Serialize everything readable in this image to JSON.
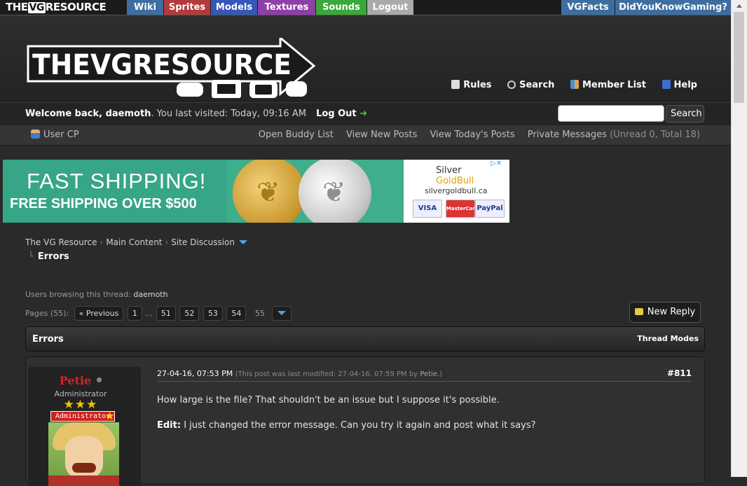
{
  "network_bar": {
    "logo": "THEVGRESOURCE",
    "logo_the": "THE",
    "logo_vg": "VG",
    "logo_rest": "RESOURCE",
    "tabs": [
      "Wiki",
      "Sprites",
      "Models",
      "Textures",
      "Sounds",
      "Logout"
    ],
    "right_tabs": [
      "VGFacts",
      "DidYouKnowGaming?"
    ],
    "tab_colors": {
      "Wiki": "#3d6ea1",
      "Sprites": "#b33b3b",
      "Models": "#3458b8",
      "Textures": "#8e3fa8",
      "Sounds": "#3ba83b",
      "Logout": "#aaaaaa"
    }
  },
  "header": {
    "logo_text": "THEVGRESOURCE",
    "links": [
      {
        "label": "Rules",
        "icon": "document-icon"
      },
      {
        "label": "Search",
        "icon": "magnifier-icon"
      },
      {
        "label": "Member List",
        "icon": "users-icon"
      },
      {
        "label": "Help",
        "icon": "help-icon"
      }
    ]
  },
  "welcome": {
    "prefix": "Welcome back, ",
    "username": "daemoth",
    "visited": ". You last visited: Today, 09:16 AM",
    "logout": "Log Out",
    "search_button": "Search",
    "search_value": ""
  },
  "usernav": {
    "user_cp": "User CP",
    "links": [
      "Open Buddy List",
      "View New Posts",
      "View Today's Posts"
    ],
    "pm_label": "Private Messages",
    "pm_counts": "(Unread 0, Total 18)"
  },
  "ad": {
    "line1": "FAST SHIPPING!",
    "line2": "FREE SHIPPING OVER $500",
    "brand_silver": "Silver",
    "brand_gold": "GoldBull",
    "url": "silvergoldbull.ca",
    "cards": [
      "VISA",
      "MasterCard",
      "PayPal"
    ]
  },
  "breadcrumb": {
    "items": [
      "The VG Resource",
      "Main Content",
      "Site Discussion"
    ],
    "current": "Errors"
  },
  "thread": {
    "browsing_label": "Users browsing this thread: ",
    "browsing_users": "daemoth",
    "pages_label": "Pages (55):",
    "prev_label": "« Previous",
    "pages": [
      "1",
      "51",
      "52",
      "53",
      "54"
    ],
    "ellipsis": "...",
    "current_page": "55",
    "new_reply": "New Reply",
    "title": "Errors",
    "thread_modes": "Thread Modes"
  },
  "post": {
    "author": "Petie",
    "user_title": "Administrator",
    "stars": "★★★",
    "badge": "Administrator",
    "date": "27-04-16, 07:53 PM",
    "modified_prefix": "(This post was last modified: 27-04-16, 07:59 PM by ",
    "modified_by": "Petie",
    "modified_suffix": ".)",
    "number": "#811",
    "body1": "How large is the file? That shouldn't be an issue but I suppose it's possible.",
    "edit_label": "Edit:",
    "body2": " I just changed the error message. Can you try it again and post what it says?"
  }
}
